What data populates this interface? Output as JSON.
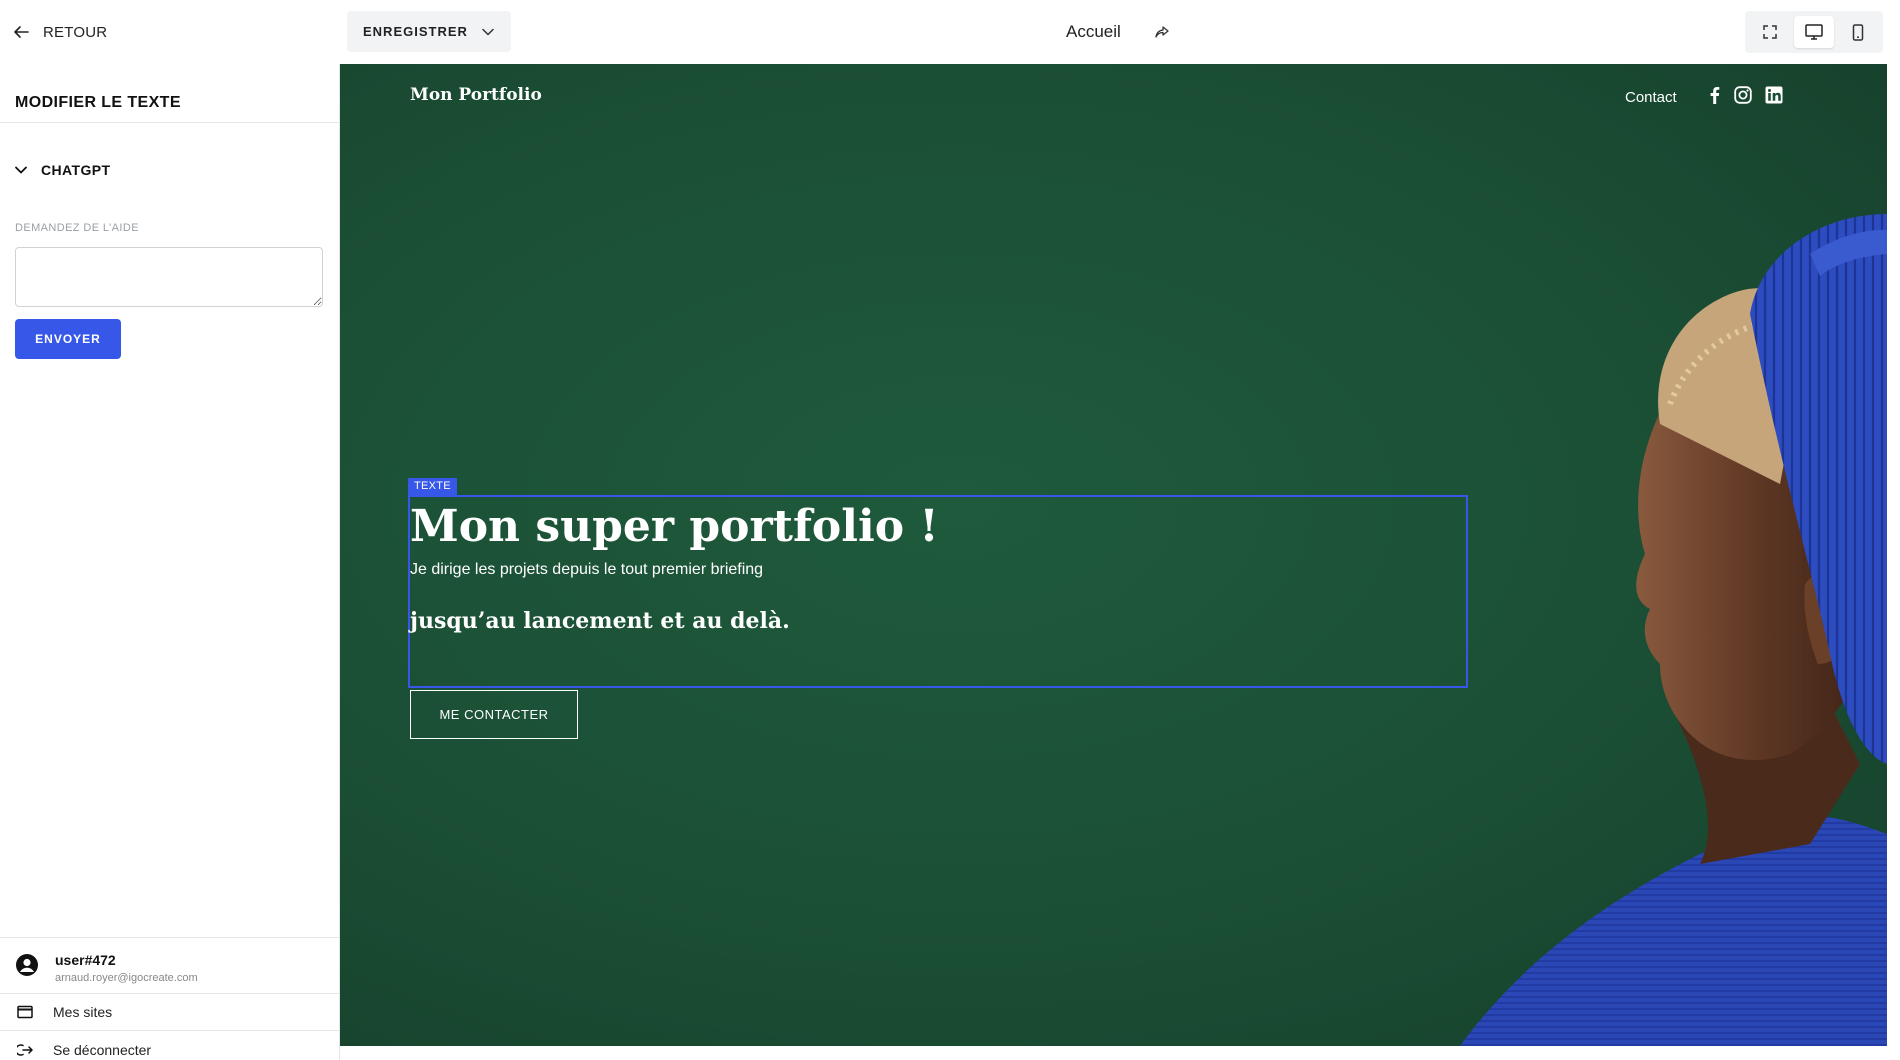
{
  "topbar": {
    "back_label": "RETOUR",
    "save_label": "ENREGISTRER",
    "page_label": "Accueil"
  },
  "panel": {
    "title": "MODIFIER LE TEXTE",
    "section_label": "CHATGPT",
    "help_label": "DEMANDEZ DE L’AIDE",
    "help_value": "",
    "send_label": "ENVOYER"
  },
  "user": {
    "name": "user#472",
    "email": "arnaud.royer@igocreate.com",
    "sites_label": "Mes sites",
    "logout_label": "Se déconnecter"
  },
  "preview": {
    "logo": "Mon Portfolio",
    "nav_contact": "Contact",
    "selection_tag": "TEXTE",
    "hero_title": "Mon super portfolio !",
    "hero_line1": "Je dirige les projets depuis le tout premier briefing",
    "hero_line2": "jusqu’au lancement et au delà.",
    "cta_label": "ME CONTACTER"
  },
  "colors": {
    "accent": "#3757e8",
    "hero_background": "#1b4f35",
    "sweater": "#2540a8"
  },
  "icons": {
    "back": "arrow-left-icon",
    "save_menu": "chevron-down-icon",
    "page_link": "share-arrow-icon",
    "fullscreen": "fullscreen-icon",
    "desktop": "desktop-icon",
    "mobile": "mobile-icon",
    "section": "chevron-down-icon",
    "avatar": "user-circle-icon",
    "sites": "browser-window-icon",
    "logout": "logout-icon",
    "social": [
      "facebook-icon",
      "instagram-icon",
      "linkedin-icon"
    ]
  }
}
